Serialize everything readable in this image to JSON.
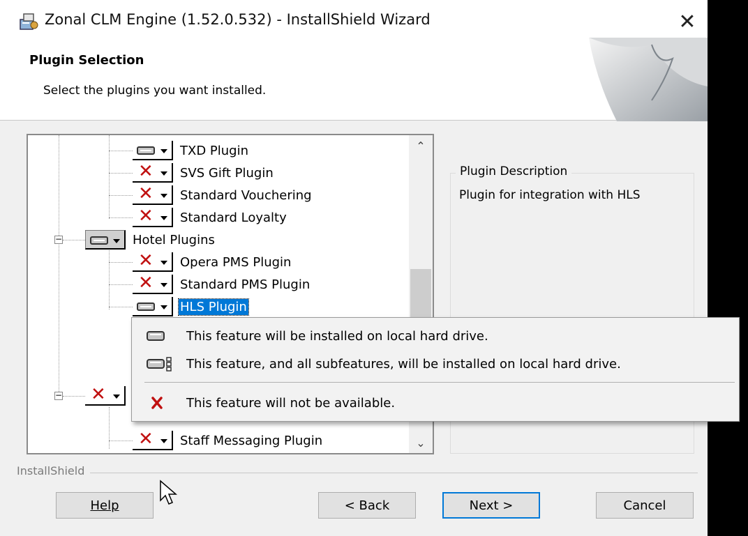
{
  "window": {
    "title": "Zonal CLM Engine (1.52.0.532) - InstallShield Wizard",
    "close_glyph": "✕"
  },
  "banner": {
    "title": "Plugin Selection",
    "subtitle": "Select the plugins you want installed."
  },
  "tree": {
    "items": [
      {
        "label": "TXD Plugin",
        "state": "install"
      },
      {
        "label": "SVS Gift Plugin",
        "state": "unavailable"
      },
      {
        "label": "Standard Vouchering",
        "state": "unavailable"
      },
      {
        "label": "Standard Loyalty",
        "state": "unavailable"
      },
      {
        "label": "Hotel Plugins",
        "state": "install"
      },
      {
        "label": "Opera PMS Plugin",
        "state": "unavailable"
      },
      {
        "label": "Standard PMS Plugin",
        "state": "unavailable"
      },
      {
        "label": "HLS Plugin",
        "state": "install"
      },
      {
        "label": "Staff Messaging Plugin",
        "state": "unavailable"
      }
    ]
  },
  "description": {
    "legend": "Plugin Description",
    "text": "Plugin for integration with HLS"
  },
  "popup_menu": {
    "items": [
      {
        "label": "This feature will be installed on local hard drive.",
        "icon": "hard-drive-icon"
      },
      {
        "label": "This feature, and all subfeatures, will be installed on local hard drive.",
        "icon": "hard-drive-subfeatures-icon"
      },
      {
        "label": "This feature will not be available.",
        "icon": "red-x-icon"
      }
    ]
  },
  "footer": {
    "brand": "InstallShield",
    "help_label": "Help",
    "back_label": "< Back",
    "next_label": "Next >",
    "cancel_label": "Cancel"
  },
  "colors": {
    "accent": "#0078d7",
    "unavailable_x": "#c01010"
  }
}
